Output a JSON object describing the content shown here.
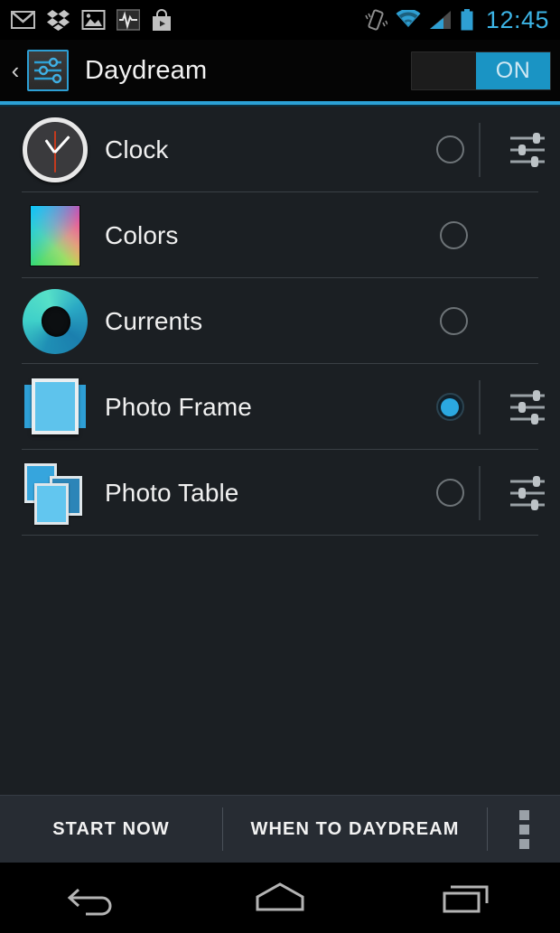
{
  "status_bar": {
    "time": "12:45",
    "left_icons": [
      {
        "name": "gmail-icon",
        "label": "Gmail"
      },
      {
        "name": "dropbox-icon",
        "label": "Dropbox"
      },
      {
        "name": "gallery-icon",
        "label": "Gallery"
      },
      {
        "name": "pulse-icon",
        "label": "Pulse"
      },
      {
        "name": "play-store-icon",
        "label": "Play Store"
      }
    ],
    "right_icons": [
      {
        "name": "vibrate-icon",
        "label": "Vibrate"
      },
      {
        "name": "wifi-icon",
        "label": "Wi-Fi"
      },
      {
        "name": "cellular-signal-icon",
        "label": "Signal"
      },
      {
        "name": "battery-icon",
        "label": "Battery"
      }
    ],
    "accent_color": "#3cb4e5"
  },
  "action_bar": {
    "back_glyph": "‹",
    "app_icon": "sliders-icon",
    "title": "Daydream",
    "toggle": {
      "label": "ON",
      "state": "on",
      "on_color": "#1a94c4"
    },
    "accent_color": "#2ba1d6"
  },
  "dream_list": {
    "selected": "Photo Frame",
    "items": [
      {
        "label": "Clock",
        "icon": "clock-icon",
        "selected": false,
        "has_settings": true
      },
      {
        "label": "Colors",
        "icon": "colors-gradient-icon",
        "selected": false,
        "has_settings": false
      },
      {
        "label": "Currents",
        "icon": "currents-ring-icon",
        "selected": false,
        "has_settings": false
      },
      {
        "label": "Photo Frame",
        "icon": "photo-frame-icon",
        "selected": true,
        "has_settings": true
      },
      {
        "label": "Photo Table",
        "icon": "photo-table-icon",
        "selected": false,
        "has_settings": true
      }
    ],
    "radio_selected_color": "#2ba8e0"
  },
  "button_bar": {
    "start_now": "START NOW",
    "when_to_daydream": "WHEN TO DAYDREAM",
    "overflow": "overflow-menu-icon"
  },
  "nav_bar": {
    "back": "back-nav-icon",
    "home": "home-nav-icon",
    "recents": "recents-nav-icon"
  }
}
